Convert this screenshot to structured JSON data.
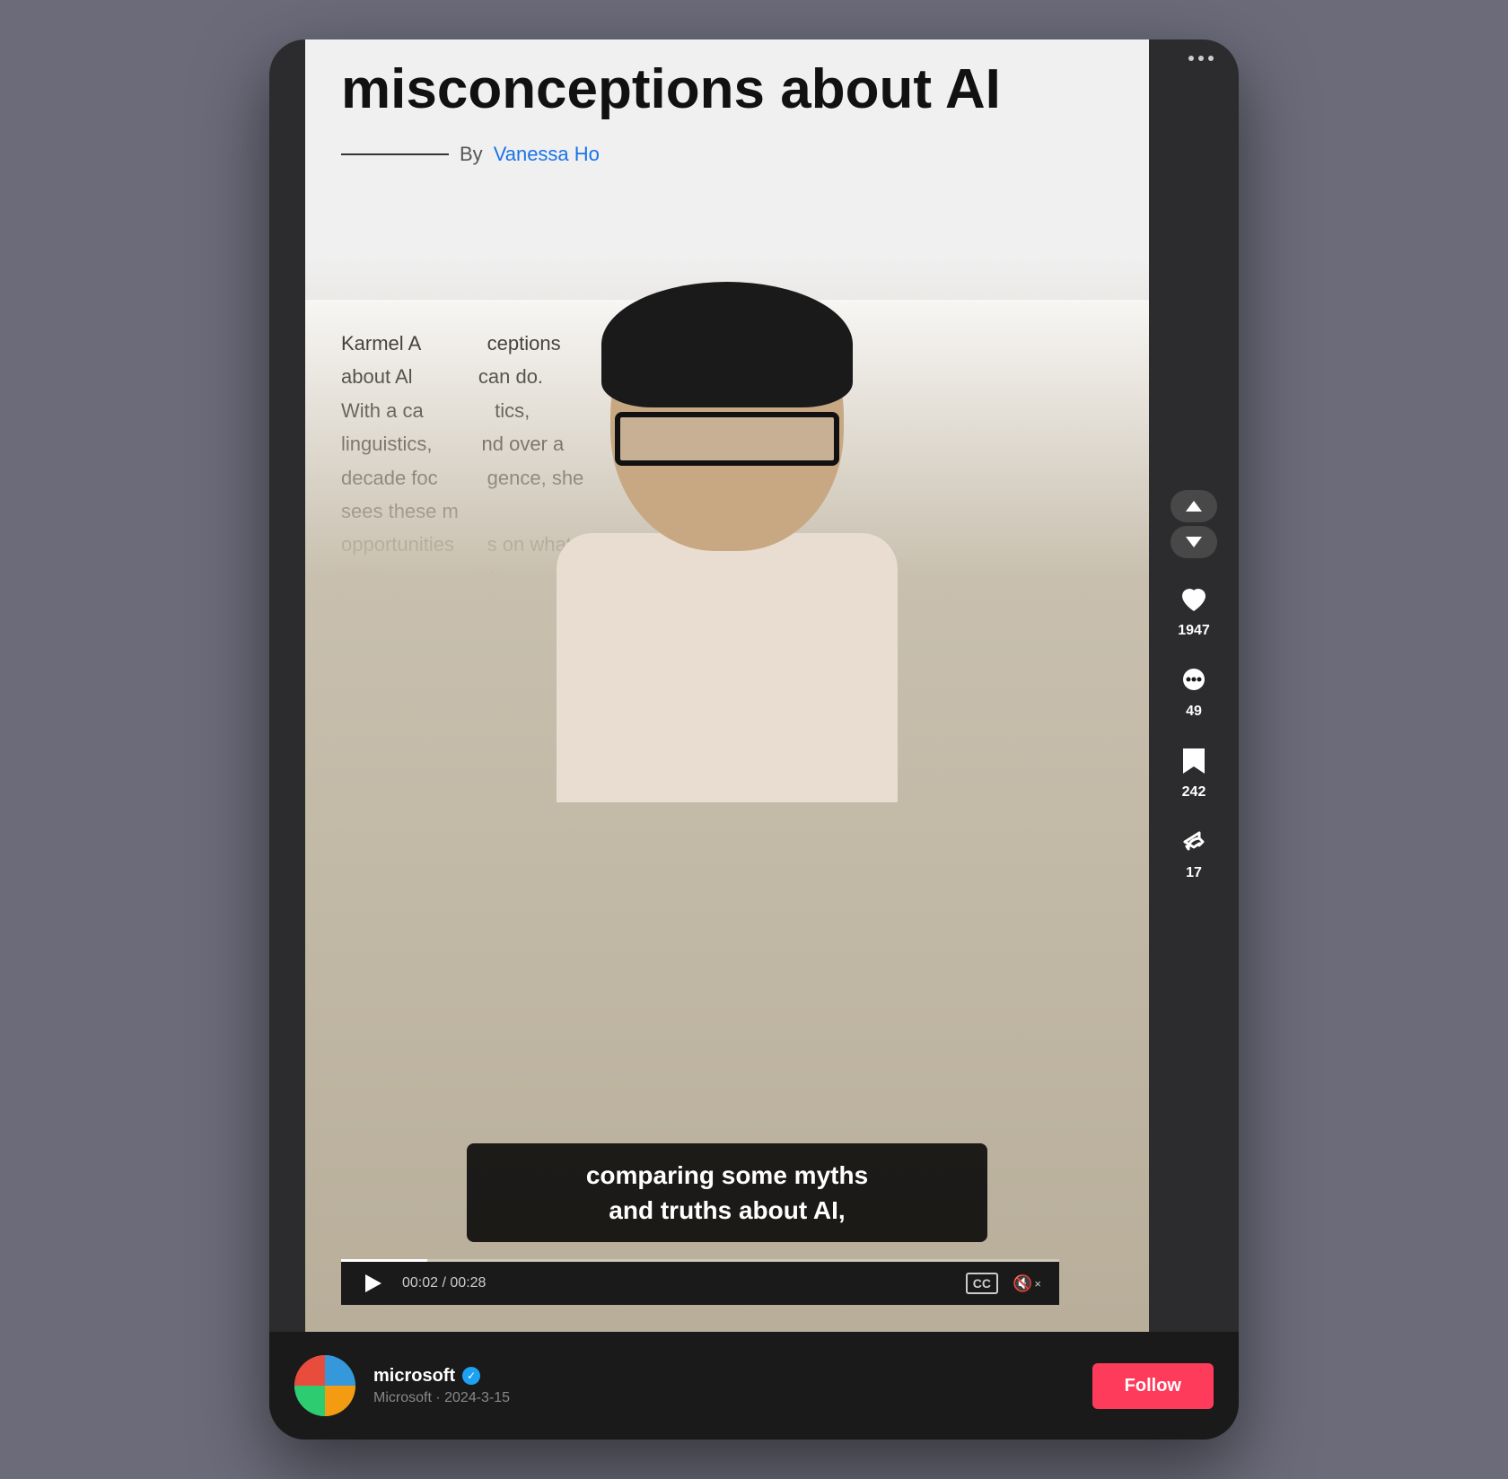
{
  "ui": {
    "background_color": "#6b6b7a",
    "frame_color": "#2c2c2e"
  },
  "header": {
    "more_icon": "···"
  },
  "article": {
    "title": "misconceptions about AI",
    "byline_prefix": "By",
    "author_name": "Vanessa Ho"
  },
  "article_body": {
    "text": "Karmel A... ceptions about Al... can do. With a ca... tics, linguistics,... nd over a decade foc... gence, she sees these m... opportunities... s on what it mea... ugh"
  },
  "subtitle": {
    "line1": "comparing some myths",
    "line2": "and truths about AI,"
  },
  "controls": {
    "play_label": "▶",
    "current_time": "00:02",
    "total_time": "00:28",
    "time_separator": " / ",
    "cc_label": "CC",
    "mute_label": "🔇×"
  },
  "progress": {
    "percent": 12
  },
  "sidebar": {
    "nav_up_label": "up",
    "nav_down_label": "down",
    "like_count": "1947",
    "comment_count": "49",
    "save_count": "242",
    "share_count": "17"
  },
  "bottom_bar": {
    "account_name": "microsoft",
    "verified": true,
    "account_meta": "Microsoft · 2024-3-15",
    "follow_label": "Follow"
  }
}
